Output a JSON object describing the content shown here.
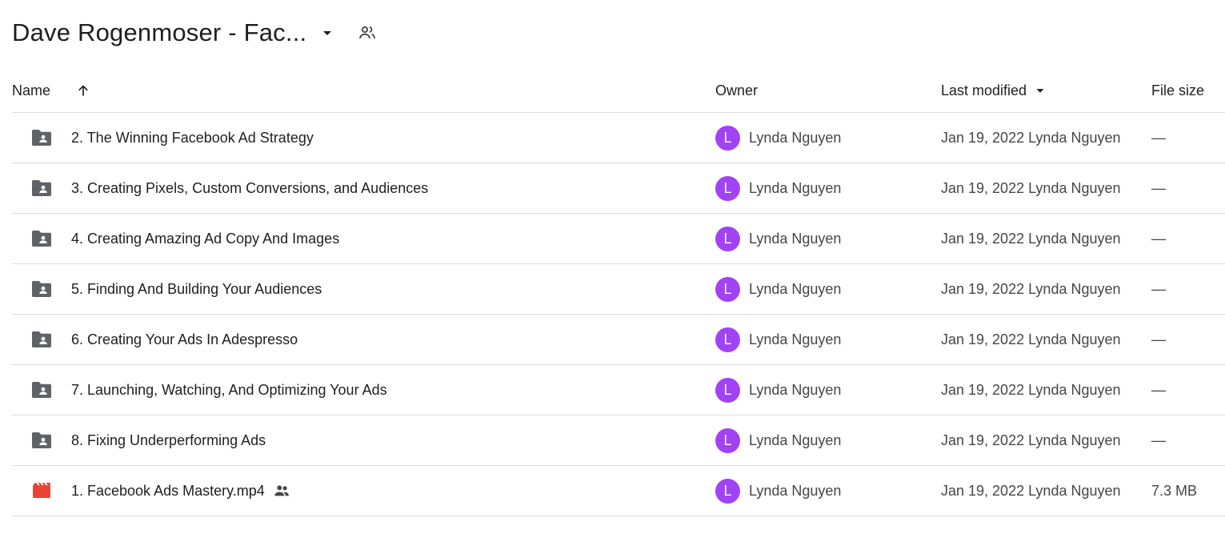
{
  "header": {
    "folder_title": "Dave Rogenmoser - Fac...",
    "caret_icon": "arrow-drop-down-icon",
    "shared_icon": "people-icon"
  },
  "columns": {
    "name": "Name",
    "owner": "Owner",
    "last_modified": "Last modified",
    "file_size": "File size",
    "sort_direction": "ascending"
  },
  "colors": {
    "avatar_bg": "#a142f4",
    "folder_icon": "#5f6368",
    "video_icon": "#ea4335",
    "divider": "#dadce0"
  },
  "files": [
    {
      "type": "folder",
      "icon": "shared-folder-icon",
      "name": "2. The Winning Facebook Ad Strategy",
      "shared": false,
      "owner_initial": "L",
      "owner": "Lynda Nguyen",
      "modified": "Jan 19, 2022 Lynda Nguyen",
      "size": "—"
    },
    {
      "type": "folder",
      "icon": "shared-folder-icon",
      "name": "3. Creating Pixels, Custom Conversions, and Audiences",
      "shared": false,
      "owner_initial": "L",
      "owner": "Lynda Nguyen",
      "modified": "Jan 19, 2022 Lynda Nguyen",
      "size": "—"
    },
    {
      "type": "folder",
      "icon": "shared-folder-icon",
      "name": "4. Creating Amazing Ad Copy And Images",
      "shared": false,
      "owner_initial": "L",
      "owner": "Lynda Nguyen",
      "modified": "Jan 19, 2022 Lynda Nguyen",
      "size": "—"
    },
    {
      "type": "folder",
      "icon": "shared-folder-icon",
      "name": "5. Finding And Building Your Audiences",
      "shared": false,
      "owner_initial": "L",
      "owner": "Lynda Nguyen",
      "modified": "Jan 19, 2022 Lynda Nguyen",
      "size": "—"
    },
    {
      "type": "folder",
      "icon": "shared-folder-icon",
      "name": "6. Creating Your Ads In Adespresso",
      "shared": false,
      "owner_initial": "L",
      "owner": "Lynda Nguyen",
      "modified": "Jan 19, 2022 Lynda Nguyen",
      "size": "—"
    },
    {
      "type": "folder",
      "icon": "shared-folder-icon",
      "name": "7. Launching, Watching, And Optimizing Your Ads",
      "shared": false,
      "owner_initial": "L",
      "owner": "Lynda Nguyen",
      "modified": "Jan 19, 2022 Lynda Nguyen",
      "size": "—"
    },
    {
      "type": "folder",
      "icon": "shared-folder-icon",
      "name": "8. Fixing Underperforming Ads",
      "shared": false,
      "owner_initial": "L",
      "owner": "Lynda Nguyen",
      "modified": "Jan 19, 2022 Lynda Nguyen",
      "size": "—"
    },
    {
      "type": "video",
      "icon": "video-file-icon",
      "name": "1. Facebook Ads Mastery.mp4",
      "shared": true,
      "owner_initial": "L",
      "owner": "Lynda Nguyen",
      "modified": "Jan 19, 2022 Lynda Nguyen",
      "size": "7.3 MB"
    }
  ]
}
